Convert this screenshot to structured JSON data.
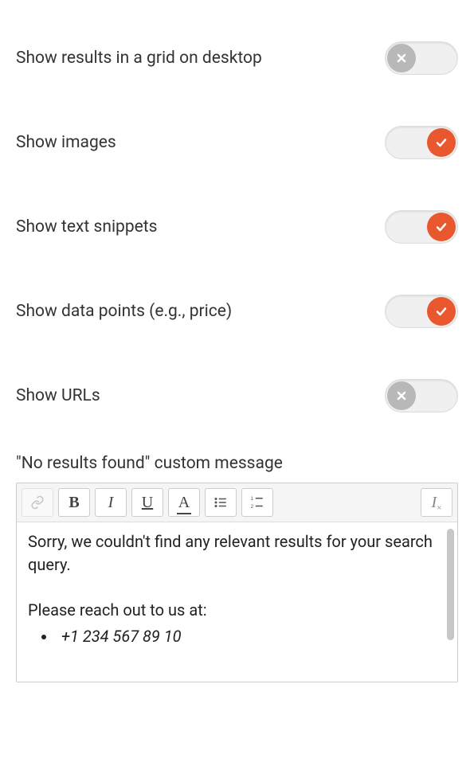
{
  "settings": [
    {
      "key": "grid",
      "label": "Show results in a grid on desktop",
      "value": false
    },
    {
      "key": "images",
      "label": "Show images",
      "value": true
    },
    {
      "key": "snippets",
      "label": "Show text snippets",
      "value": true
    },
    {
      "key": "datapts",
      "label": "Show data points (e.g., price)",
      "value": true
    },
    {
      "key": "urls",
      "label": "Show URLs",
      "value": false
    }
  ],
  "editor": {
    "heading": "\"No results found\" custom message",
    "content": {
      "para1": "Sorry, we couldn't find any relevant results for your search query.",
      "para2": "Please reach out to us at:",
      "bullet1": "+1 234 567 89 10"
    },
    "toolbar": {
      "link": {
        "name": "link-icon"
      },
      "bold": {
        "name": "bold-icon",
        "glyph": "B"
      },
      "italic": {
        "name": "italic-icon",
        "glyph": "I"
      },
      "under": {
        "name": "underline-icon"
      },
      "color": {
        "name": "text-color-icon"
      },
      "ulist": {
        "name": "unordered-list-icon"
      },
      "olist": {
        "name": "ordered-list-icon"
      },
      "clear": {
        "name": "clear-format-icon"
      }
    }
  },
  "colors": {
    "accent": "#e8572e",
    "off": "#b8b8b8"
  }
}
